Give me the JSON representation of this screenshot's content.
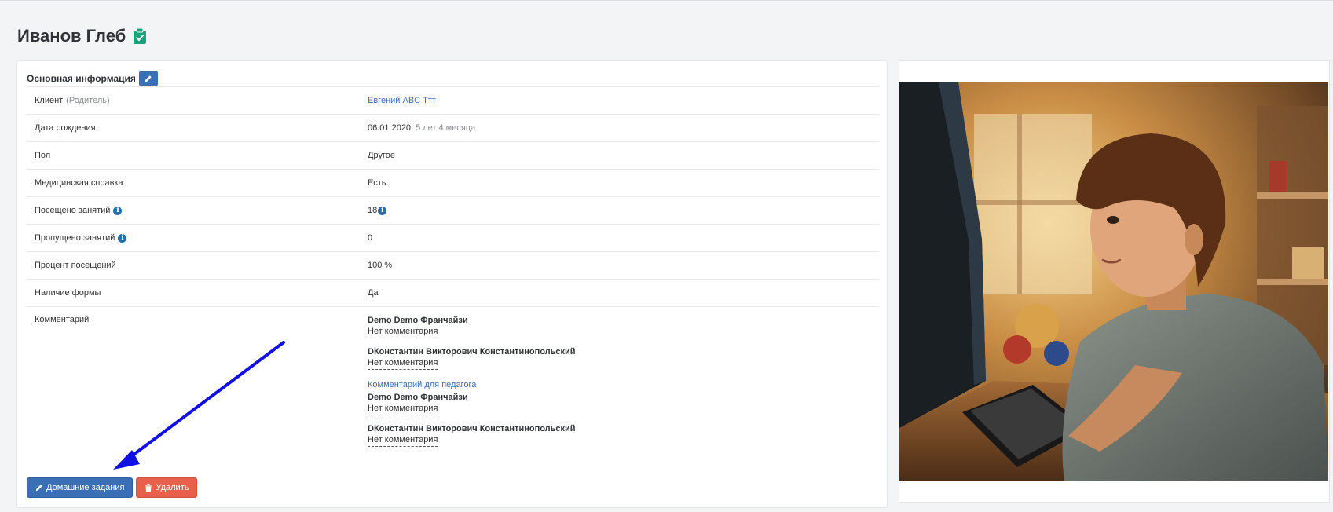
{
  "page": {
    "title": "Иванов Глеб"
  },
  "panel": {
    "header": "Основная информация"
  },
  "rows": [
    {
      "label": "Клиент",
      "label_note": "(Родитель)",
      "value": "Евгений ABC Ттт"
    },
    {
      "label": "Дата рождения",
      "value": "06.01.2020",
      "value_note": "5 лет 4 месяца"
    },
    {
      "label": "Пол",
      "value": "Другое"
    },
    {
      "label": "Медицинская справка",
      "value": "Есть."
    },
    {
      "label": "Посещено занятий",
      "value": "18"
    },
    {
      "label": "Пропущено занятий",
      "value": "0"
    },
    {
      "label": "Процент посещений",
      "value": "100 %"
    },
    {
      "label": "Наличие формы",
      "value": "Да"
    },
    {
      "label": "Комментарий"
    }
  ],
  "comments": {
    "general": [
      {
        "author": "Demo Demo Франчайзи",
        "text": "Нет комментария"
      },
      {
        "author": "DКонстантин Викторович Константинопольский",
        "text": "Нет комментария"
      }
    ],
    "teacher_heading": "Комментарий для педагога",
    "teacher": [
      {
        "author": "Demo Demo Франчайзи",
        "text": "Нет комментария"
      },
      {
        "author": "DКонстантин Викторович Константинопольский",
        "text": "Нет комментария"
      }
    ]
  },
  "buttons": {
    "homework": "Домашние задания",
    "delete": "Удалить"
  },
  "icons": {
    "title_badge": "clipboard-check-icon",
    "edit": "pencil-icon",
    "info": "info-icon",
    "trash": "trash-icon"
  },
  "colors": {
    "primary": "#3a6eb5",
    "danger": "#e8604c",
    "badge": "#1aa37a",
    "annotation_arrow": "#1010e6"
  }
}
